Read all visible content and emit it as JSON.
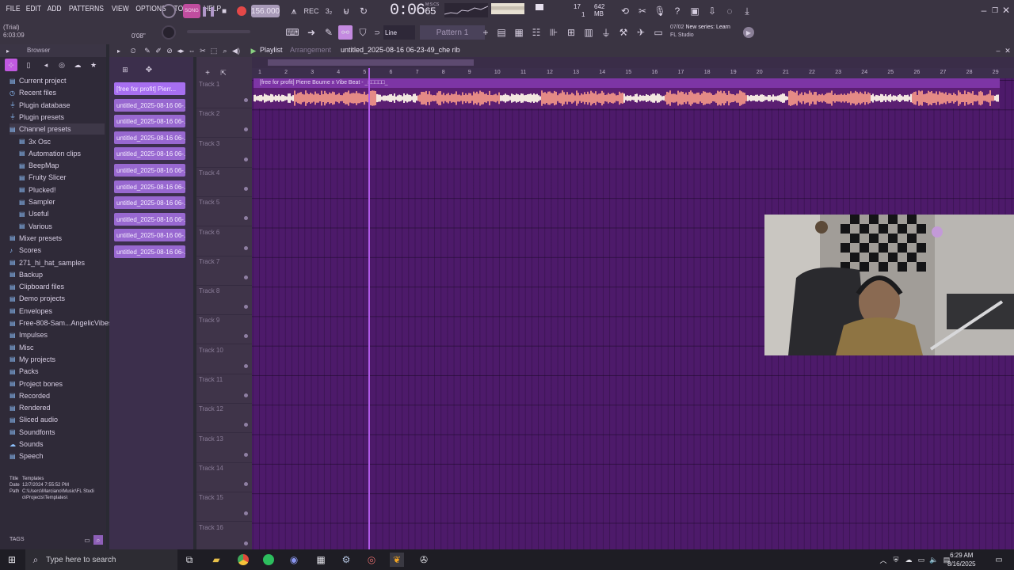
{
  "menu": [
    "FILE",
    "EDIT",
    "ADD",
    "PATTERNS",
    "VIEW",
    "OPTIONS",
    "TOOLS",
    "HELP"
  ],
  "trial": {
    "label": "(Trial)",
    "time": "6:03:09",
    "pos": "0'08\""
  },
  "transport": {
    "tempo": "156.000",
    "time": "0:06",
    "time_frac": "65",
    "msc": "M:S:CS"
  },
  "mem": {
    "voices": "17",
    "ram": "642 MB",
    "cores": "1"
  },
  "toolbar": {
    "snap": "Line",
    "pattern": "Pattern 1"
  },
  "news": {
    "line1_date": "07/02",
    "line1_text": "New series: Learn",
    "line2": "FL Studio"
  },
  "browser": {
    "title": "Browser",
    "items": [
      {
        "label": "Current project",
        "sub": false,
        "icon": "folder-icon"
      },
      {
        "label": "Recent files",
        "sub": false,
        "icon": "clock-icon"
      },
      {
        "label": "Plugin database",
        "sub": false,
        "icon": "plug-icon"
      },
      {
        "label": "Plugin presets",
        "sub": false,
        "icon": "plug-icon"
      },
      {
        "label": "Channel presets",
        "sub": false,
        "icon": "folder-icon",
        "selected": true
      },
      {
        "label": "3x Osc",
        "sub": true,
        "icon": "folder-icon"
      },
      {
        "label": "Automation clips",
        "sub": true,
        "icon": "folder-icon"
      },
      {
        "label": "BeepMap",
        "sub": true,
        "icon": "folder-icon"
      },
      {
        "label": "Fruity Slicer",
        "sub": true,
        "icon": "folder-icon"
      },
      {
        "label": "Plucked!",
        "sub": true,
        "icon": "folder-icon"
      },
      {
        "label": "Sampler",
        "sub": true,
        "icon": "folder-icon"
      },
      {
        "label": "Useful",
        "sub": true,
        "icon": "folder-icon"
      },
      {
        "label": "Various",
        "sub": true,
        "icon": "folder-icon"
      },
      {
        "label": "Mixer presets",
        "sub": false,
        "icon": "folder-icon"
      },
      {
        "label": "Scores",
        "sub": false,
        "icon": "note-icon"
      },
      {
        "label": "271_hi_hat_samples",
        "sub": false,
        "icon": "folder-icon"
      },
      {
        "label": "Backup",
        "sub": false,
        "icon": "folder-icon"
      },
      {
        "label": "Clipboard files",
        "sub": false,
        "icon": "folder-icon"
      },
      {
        "label": "Demo projects",
        "sub": false,
        "icon": "folder-icon"
      },
      {
        "label": "Envelopes",
        "sub": false,
        "icon": "folder-icon"
      },
      {
        "label": "Free-808-Sam...AngelicVibes",
        "sub": false,
        "icon": "folder-icon"
      },
      {
        "label": "Impulses",
        "sub": false,
        "icon": "folder-icon"
      },
      {
        "label": "Misc",
        "sub": false,
        "icon": "folder-icon"
      },
      {
        "label": "My projects",
        "sub": false,
        "icon": "folder-icon"
      },
      {
        "label": "Packs",
        "sub": false,
        "icon": "folder-icon"
      },
      {
        "label": "Project bones",
        "sub": false,
        "icon": "folder-icon"
      },
      {
        "label": "Recorded",
        "sub": false,
        "icon": "folder-icon"
      },
      {
        "label": "Rendered",
        "sub": false,
        "icon": "folder-icon"
      },
      {
        "label": "Sliced audio",
        "sub": false,
        "icon": "folder-icon"
      },
      {
        "label": "Soundfonts",
        "sub": false,
        "icon": "folder-icon"
      },
      {
        "label": "Sounds",
        "sub": false,
        "icon": "cloud-icon"
      },
      {
        "label": "Speech",
        "sub": false,
        "icon": "folder-icon"
      }
    ],
    "info": {
      "title_k": "Title",
      "title_v": "Templates",
      "date_k": "Date",
      "date_v": "12/7/2024 7:55:52 PM",
      "path_k": "Path",
      "path_v": "C:\\Users\\Marciano\\Music\\FL Studio\\Projects\\Templates\\"
    },
    "tags": "TAGS"
  },
  "playlist": {
    "title": "Playlist",
    "mode": "Arrangement",
    "file": "untitled_2025-08-16 06-23-49_che rib",
    "patterns": [
      "[free for profit] Pierr...",
      "untitled_2025-08-16 06-...",
      "untitled_2025-08-16 06-...",
      "untitled_2025-08-16 06-...",
      "untitled_2025-08-16 06-...",
      "untitled_2025-08-16 06-...",
      "untitled_2025-08-16 06-...",
      "untitled_2025-08-16 06-...",
      "untitled_2025-08-16 06-...",
      "untitled_2025-08-16 06-...",
      "untitled_2025-08-16 06-..."
    ],
    "tracks": [
      "Track 1",
      "Track 2",
      "Track 3",
      "Track 4",
      "Track 5",
      "Track 6",
      "Track 7",
      "Track 8",
      "Track 9",
      "Track 10",
      "Track 11",
      "Track 12",
      "Track 13",
      "Track 14",
      "Track 15",
      "Track 16"
    ],
    "bars": [
      "1",
      "2",
      "3",
      "4",
      "5",
      "6",
      "7",
      "8",
      "9",
      "10",
      "11",
      "12",
      "13",
      "14",
      "15",
      "16",
      "17",
      "18",
      "19",
      "20",
      "21",
      "22",
      "23",
      "24",
      "25",
      "26",
      "27",
      "28",
      "29"
    ],
    "clip_title": "[free for profit] Pierre Bourne x Vibe Beat - _□□□□□_",
    "playhead_bar": 5.2
  },
  "taskbar": {
    "search": "Type here to search",
    "time": "6:29 AM",
    "date": "8/16/2025"
  }
}
